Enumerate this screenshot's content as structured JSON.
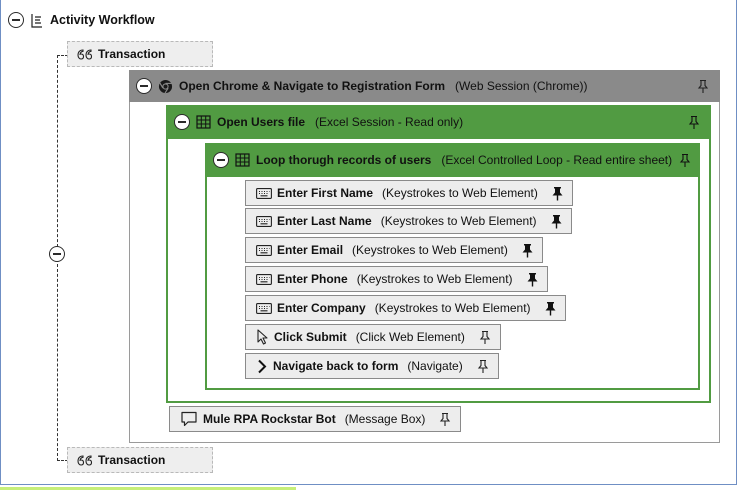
{
  "workflow": {
    "title": "Activity Workflow"
  },
  "transaction_top": {
    "label": "Transaction"
  },
  "transaction_bottom": {
    "label": "Transaction"
  },
  "chrome_session": {
    "title": "Open Chrome & Navigate to Registration Form",
    "note": "(Web Session (Chrome))"
  },
  "excel_session": {
    "title": "Open Users file",
    "note": "(Excel Session - Read only)"
  },
  "loop": {
    "title": "Loop thorugh records of users",
    "note": "(Excel Controlled Loop - Read entire sheet)"
  },
  "activities": [
    {
      "title": "Enter First Name",
      "note": "(Keystrokes to Web Element)",
      "icon": "keyboard-icon",
      "pinned": true
    },
    {
      "title": "Enter Last Name",
      "note": "(Keystrokes to Web Element)",
      "icon": "keyboard-icon",
      "pinned": true
    },
    {
      "title": "Enter Email",
      "note": "(Keystrokes to Web Element)",
      "icon": "keyboard-icon",
      "pinned": true
    },
    {
      "title": "Enter Phone",
      "note": "(Keystrokes to Web Element)",
      "icon": "keyboard-icon",
      "pinned": true
    },
    {
      "title": "Enter Company",
      "note": "(Keystrokes to Web Element)",
      "icon": "keyboard-icon",
      "pinned": true
    },
    {
      "title": "Click Submit",
      "note": "(Click Web Element)",
      "icon": "cursor-icon",
      "pinned": false
    },
    {
      "title": "Navigate back to form",
      "note": "(Navigate)",
      "icon": "chevron-right-icon",
      "pinned": false
    }
  ],
  "message_box": {
    "title": "Mule RPA Rockstar Bot",
    "note": "(Message Box)"
  },
  "colors": {
    "session_green": "#519b42",
    "chrome_gray": "#8a8a8a",
    "frame_blue": "#6f8fc4"
  }
}
